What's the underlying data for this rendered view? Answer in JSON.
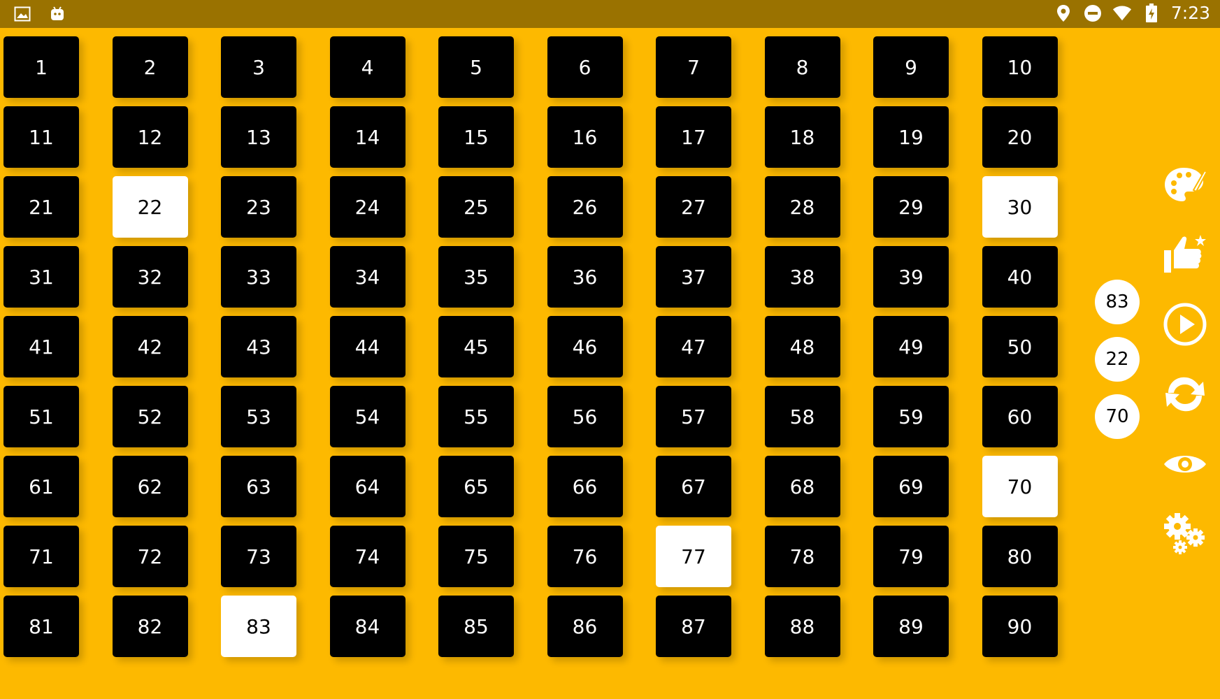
{
  "status_bar": {
    "time": "7:23",
    "left_icons": [
      "image-icon",
      "android-icon"
    ],
    "right_icons": [
      "location-icon",
      "do-not-disturb-icon",
      "wifi-icon",
      "battery-charging-icon"
    ]
  },
  "board": {
    "numbers": [
      "1",
      "2",
      "3",
      "4",
      "5",
      "6",
      "7",
      "8",
      "9",
      "10",
      "11",
      "12",
      "13",
      "14",
      "15",
      "16",
      "17",
      "18",
      "19",
      "20",
      "21",
      "22",
      "23",
      "24",
      "25",
      "26",
      "27",
      "28",
      "29",
      "30",
      "31",
      "32",
      "33",
      "34",
      "35",
      "36",
      "37",
      "38",
      "39",
      "40",
      "41",
      "42",
      "43",
      "44",
      "45",
      "46",
      "47",
      "48",
      "49",
      "50",
      "51",
      "52",
      "53",
      "54",
      "55",
      "56",
      "57",
      "58",
      "59",
      "60",
      "61",
      "62",
      "63",
      "64",
      "65",
      "66",
      "67",
      "68",
      "69",
      "70",
      "71",
      "72",
      "73",
      "74",
      "75",
      "76",
      "77",
      "78",
      "79",
      "80",
      "81",
      "82",
      "83",
      "84",
      "85",
      "86",
      "87",
      "88",
      "89",
      "90"
    ],
    "drawn": [
      22,
      30,
      70,
      77,
      83
    ]
  },
  "history": [
    "83",
    "22",
    "70"
  ],
  "toolbar": {
    "items": [
      "palette-icon",
      "rate-thumbs-up-icon",
      "play-icon",
      "refresh-icon",
      "eye-icon",
      "settings-gears-icon"
    ]
  },
  "colors": {
    "background": "#FDB900",
    "status_bar": "#9A7200",
    "cell": "#000000",
    "cell_drawn": "#FFFFFF"
  }
}
